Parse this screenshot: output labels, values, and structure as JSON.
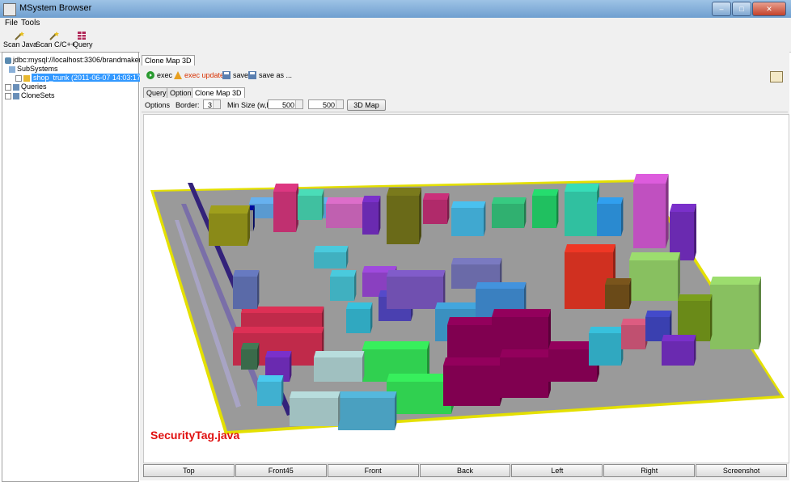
{
  "window": {
    "title": "MSystem Browser",
    "min_label": "–",
    "max_label": "□",
    "close_label": "✕"
  },
  "menu": {
    "file": "File",
    "tools": "Tools"
  },
  "toolbar": {
    "scan_java": "Scan Java",
    "scan_cpp": "Scan C/C++",
    "query": "Query"
  },
  "tree": {
    "root": "jdbc:mysql://localhost:3306/brandmaker",
    "subsystems": "SubSystems",
    "selected_node": "shop_trunk (2011-06-07 14:03:17.0)",
    "queries": "Queries",
    "clonesets": "CloneSets"
  },
  "main": {
    "top_tab": "Clone Map 3D",
    "actions": {
      "exec": "exec",
      "exec_update": "exec update",
      "save": "save",
      "save_as": "save as ..."
    },
    "inner_tabs": [
      "Query",
      "Options",
      "Clone Map 3D"
    ],
    "options": {
      "label": "Options",
      "border_label": "Border:",
      "border_value": "3",
      "min_size_label": "Min Size (w,h):",
      "min_w": "500",
      "min_h": "500",
      "map_button": "3D Map"
    },
    "file_label": "SecurityTag.java",
    "view_buttons": [
      "Top",
      "Front45",
      "Front",
      "Back",
      "Left",
      "Right",
      "Screenshot"
    ]
  },
  "colors": {
    "accent_selected": "#3399ff",
    "file_label": "#e01010",
    "exec_update": "#d83000",
    "floor": "#9a9a9a",
    "floor_border": "#e4e000"
  }
}
